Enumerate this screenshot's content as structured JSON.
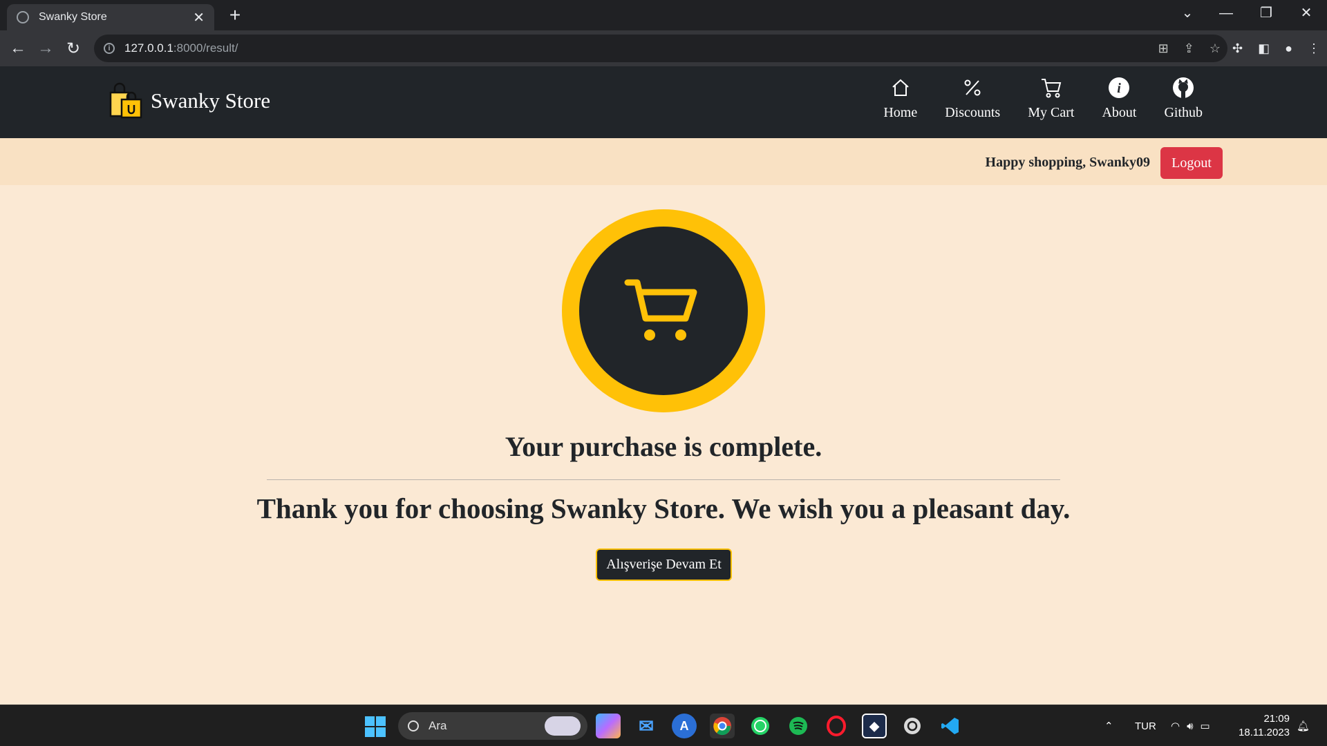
{
  "browser": {
    "tab_title": "Swanky Store",
    "tab_close": "✕",
    "new_tab": "+",
    "url_host": "127.0.0.1",
    "url_path": ":8000/result/",
    "win_minimize": "—",
    "win_restore": "❐",
    "win_close": "✕",
    "win_dropdown": "⌄"
  },
  "site": {
    "brand": "Swanky Store",
    "nav": [
      {
        "label": "Home",
        "icon": "home-icon"
      },
      {
        "label": "Discounts",
        "icon": "percent-icon"
      },
      {
        "label": "My Cart",
        "icon": "cart-icon"
      },
      {
        "label": "About",
        "icon": "info-icon"
      },
      {
        "label": "Github",
        "icon": "github-icon"
      }
    ],
    "greeting": "Happy shopping, Swanky09",
    "logout_label": "Logout"
  },
  "result": {
    "heading": "Your purchase is complete.",
    "message": "Thank you for choosing Swanky Store. We wish you a pleasant day.",
    "continue_label": "Alışverişe Devam Et"
  },
  "taskbar": {
    "search_placeholder": "Ara",
    "language": "TUR",
    "time": "21:09",
    "date": "18.11.2023"
  },
  "colors": {
    "accent": "#ffc107",
    "dark": "#212529",
    "danger": "#dc3545",
    "background": "#fbe9d4"
  }
}
